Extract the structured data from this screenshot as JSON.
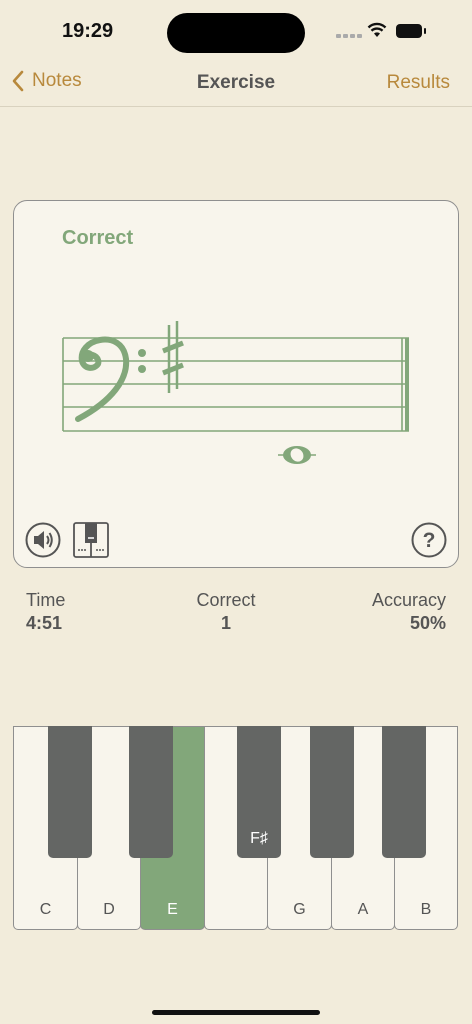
{
  "status": {
    "time": "19:29"
  },
  "nav": {
    "back_label": "Notes",
    "title": "Exercise",
    "results_label": "Results"
  },
  "card": {
    "feedback": "Correct",
    "clef": "bass",
    "key_signature": "F sharp",
    "note": "E (whole note, ledger line below staff)"
  },
  "stats": {
    "time_label": "Time",
    "time_value": "4:51",
    "correct_label": "Correct",
    "correct_value": "1",
    "accuracy_label": "Accuracy",
    "accuracy_value": "50%"
  },
  "keyboard": {
    "white_keys": [
      "C",
      "D",
      "E",
      "",
      "G",
      "A",
      "B"
    ],
    "selected_white": "E",
    "black_key_label": "F♯"
  },
  "colors": {
    "accent": "#b8893c",
    "correct_green": "#82a77a",
    "background": "#f2ecdb",
    "card": "#f8f5ec",
    "black_key": "#646664"
  }
}
